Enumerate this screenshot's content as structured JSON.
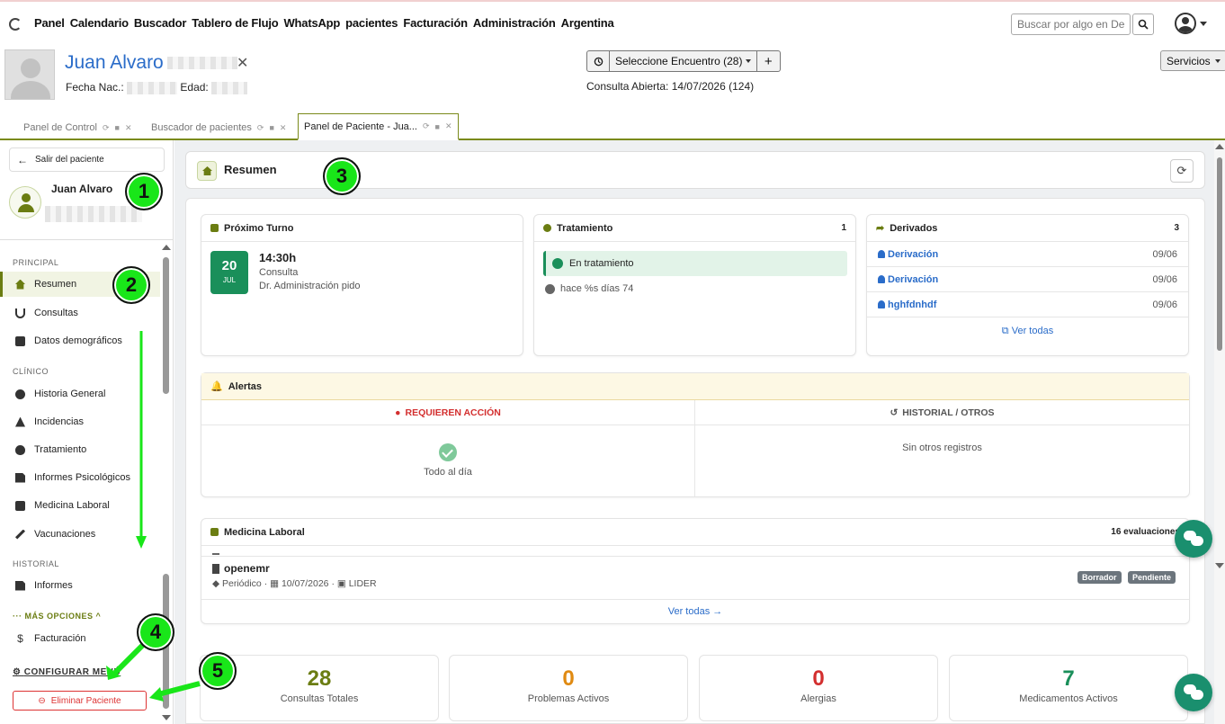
{
  "nav": {
    "items": [
      "Panel",
      "Calendario",
      "Buscador",
      "Tablero de Flujo",
      "WhatsApp",
      "pacientes",
      "Facturación",
      "Administración",
      "Argentina"
    ]
  },
  "search": {
    "placeholder": "Buscar por algo en Demog"
  },
  "patient": {
    "name": "Juan Alvaro",
    "dob_label": "Fecha Nac.:",
    "age_label": "Edad:"
  },
  "encounter": {
    "label": "Seleccione Encuentro",
    "count": "(28)",
    "add": "+",
    "open": "Consulta Abierta: 14/07/2026 (124)"
  },
  "services": {
    "label": "Servicios"
  },
  "tabs": [
    "Panel de Control",
    "Buscador de pacientes",
    "Panel de Paciente - Jua..."
  ],
  "sidebar": {
    "exit": "Salir del paciente",
    "name": "Juan Alvaro",
    "sections": [
      "PRINCIPAL",
      "CLÍNICO",
      "HISTORIAL"
    ],
    "items": [
      "Resumen",
      "Consultas",
      "Datos demográficos",
      "Historia General",
      "Incidencias",
      "Tratamiento",
      "Informes Psicológicos",
      "Medicina Laboral",
      "Vacunaciones",
      "Informes",
      "Facturación"
    ],
    "more": "MÁS OPCIONES",
    "config": "CONFIGURAR MENÚ",
    "delete": "Eliminar Paciente"
  },
  "summary": {
    "title": "Resumen",
    "next": {
      "title": "Próximo Turno",
      "day": "20",
      "month": "JUL",
      "time": "14:30h",
      "type": "Consulta",
      "doctor": "Dr. Administración pido"
    },
    "treatment": {
      "title": "Tratamiento",
      "count": "1",
      "status": "En tratamiento",
      "ago": "hace %s días 74"
    },
    "derived": {
      "title": "Derivados",
      "count": "3",
      "rows": [
        {
          "name": "Derivación",
          "date": "09/06"
        },
        {
          "name": "Derivación",
          "date": "09/06"
        },
        {
          "name": "hghfdnhdf",
          "date": "09/06"
        }
      ],
      "all": "Ver todas"
    },
    "alerts": {
      "title": "Alertas",
      "col1": "REQUIEREN ACCIÓN",
      "col1_body": "Todo al día",
      "col2": "HISTORIAL / OTROS",
      "col2_body": "Sin otros registros"
    },
    "labor": {
      "title": "Medicina Laboral",
      "count": "16 evaluaciones",
      "item_title": "openemr",
      "item_type": "Periódico",
      "item_date": "10/07/2026",
      "item_company": "LIDER",
      "tag1": "Borrador",
      "tag2": "Pendiente",
      "all": "Ver todas →"
    },
    "stats": [
      {
        "value": "28",
        "label": "Consultas Totales",
        "color": "#6b7d12"
      },
      {
        "value": "0",
        "label": "Problemas Activos",
        "color": "#e08a12"
      },
      {
        "value": "0",
        "label": "Alergias",
        "color": "#d32f2f"
      },
      {
        "value": "7",
        "label": "Medicamentos Activos",
        "color": "#1a8f5a"
      }
    ]
  },
  "annotations": [
    "1",
    "2",
    "3",
    "4",
    "5"
  ],
  "colors": {
    "accent": "#6b7d12",
    "link": "#2a6cc9",
    "danger": "#d33",
    "success": "#1a8f5a",
    "annotation": "#19e619"
  }
}
